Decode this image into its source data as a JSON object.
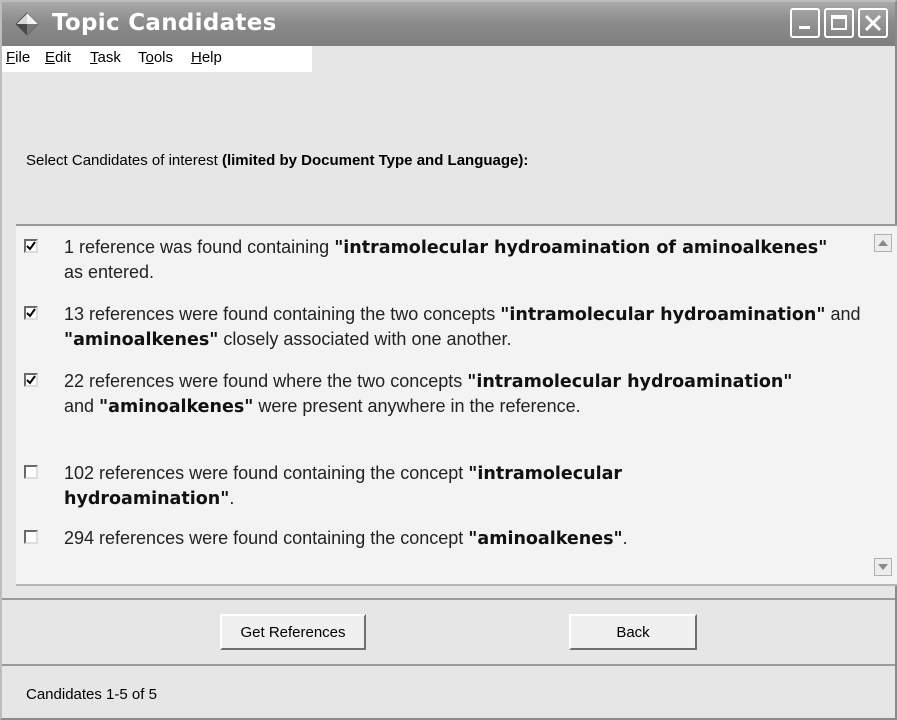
{
  "window": {
    "title": "Topic Candidates",
    "icon": "diamond-app-icon",
    "controls": [
      "minimize-icon",
      "maximize-icon",
      "close-icon"
    ]
  },
  "menu": {
    "items": [
      {
        "key": "F",
        "rest": "ile"
      },
      {
        "key": "E",
        "rest": "dit"
      },
      {
        "key": "T",
        "rest": "ask"
      },
      {
        "pre": "T",
        "key": "o",
        "rest": "ols"
      },
      {
        "key": "H",
        "rest": "elp"
      }
    ]
  },
  "prompt": {
    "text": "Select Candidates of interest ",
    "bold": "(limited by Document Type and  Language):"
  },
  "candidates": [
    {
      "checked": true,
      "parts": [
        "1 reference was found containing ",
        "\"intramolecular hydroamination of aminoalkenes\"",
        " as entered."
      ]
    },
    {
      "checked": true,
      "parts": [
        "13 references were found containing the two concepts ",
        "\"intramolecular hydroamination\"",
        " and ",
        "\"aminoalkenes\"",
        " closely associated with one another."
      ]
    },
    {
      "checked": true,
      "parts": [
        "22 references were found where the two concepts ",
        "\"intramolecular hydroamination\"",
        " and ",
        "\"aminoalkenes\"",
        " were present anywhere in the reference."
      ]
    },
    {
      "checked": false,
      "parts": [
        "102 references were found containing the concept ",
        "\"intramolecular hydroamination\"",
        "."
      ]
    },
    {
      "checked": false,
      "parts": [
        "294 references were found containing the concept ",
        "\"aminoalkenes\"",
        "."
      ]
    }
  ],
  "buttons": {
    "get_references": "Get References",
    "back": "Back"
  },
  "status": "Candidates 1-5 of 5",
  "colors": {
    "titlebar": "#8c8c8c",
    "window_bg": "#e6e6e6",
    "list_bg": "#f3f3f3"
  }
}
